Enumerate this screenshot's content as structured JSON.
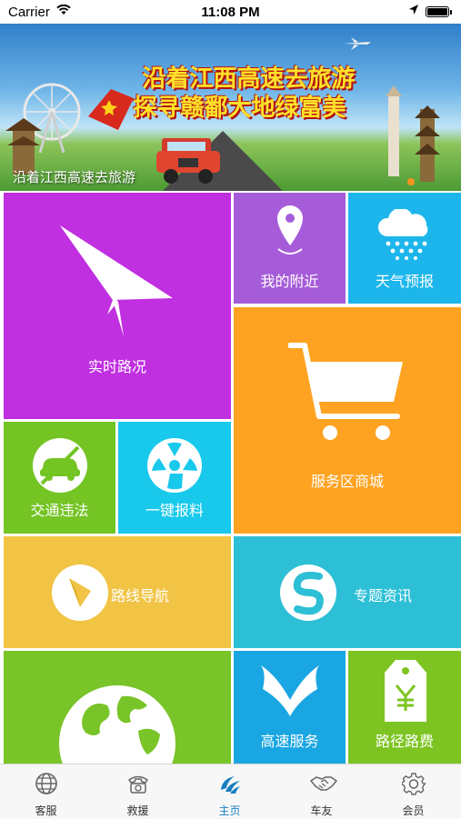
{
  "status_bar": {
    "carrier": "Carrier",
    "time": "11:08 PM"
  },
  "banner": {
    "headline_line1": "沿着江西高速去旅游",
    "headline_line2": "探寻赣鄱大地绿富美",
    "caption": "沿着江西高速去旅游"
  },
  "tiles": {
    "realtime_traffic": {
      "label": "实时路况",
      "color": "#c02fe0"
    },
    "nearby": {
      "label": "我的附近",
      "color": "#a65cd9"
    },
    "weather": {
      "label": "天气预报",
      "color": "#1cb6ec"
    },
    "service_mall": {
      "label": "服务区商城",
      "color": "#fea321"
    },
    "violation": {
      "label": "交通违法",
      "color": "#74c424"
    },
    "report": {
      "label": "一键报料",
      "color": "#18c9ec"
    },
    "route_nav": {
      "label": "路线导航",
      "color": "#f1c445"
    },
    "topics": {
      "label": "专题资讯",
      "color": "#2dbfd6"
    },
    "globe": {
      "label": "",
      "color": "#79c428"
    },
    "highway_service": {
      "label": "高速服务",
      "color": "#1aa6e2"
    },
    "toll": {
      "label": "路径路费",
      "color": "#7dc422"
    }
  },
  "tabbar": {
    "items": [
      {
        "label": "客服",
        "icon": "globe-icon"
      },
      {
        "label": "救援",
        "icon": "phone-icon"
      },
      {
        "label": "主页",
        "icon": "home-logo-icon",
        "active": true
      },
      {
        "label": "车友",
        "icon": "handshake-icon"
      },
      {
        "label": "会员",
        "icon": "gear-icon"
      }
    ]
  }
}
